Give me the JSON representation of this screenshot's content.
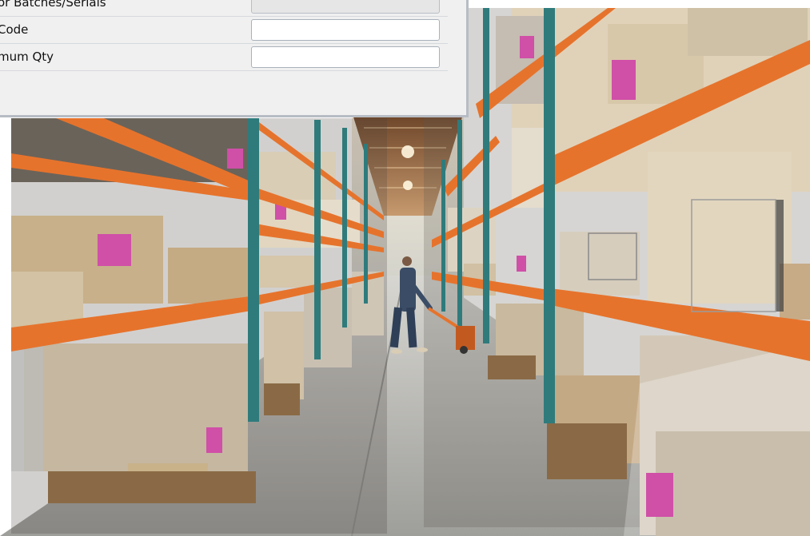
{
  "dialog": {
    "fields": [
      {
        "label": "or Batches/Serials",
        "value": "",
        "disabled": true
      },
      {
        "label": "Code",
        "value": "",
        "disabled": false
      },
      {
        "label": "mum Qty",
        "value": "",
        "disabled": false
      }
    ]
  },
  "photo": {
    "subject": "warehouse-aisle-worker-with-pallet-jack",
    "colors": {
      "shelf_orange": "#e6732c",
      "upright_teal": "#2f7b7c",
      "box_tan": "#c9b593",
      "label_pink": "#d04fa7",
      "floor_grey": "#b8b8b4",
      "ceiling_brown": "#8a5a36",
      "worker_blue": "#3b4d66"
    }
  }
}
